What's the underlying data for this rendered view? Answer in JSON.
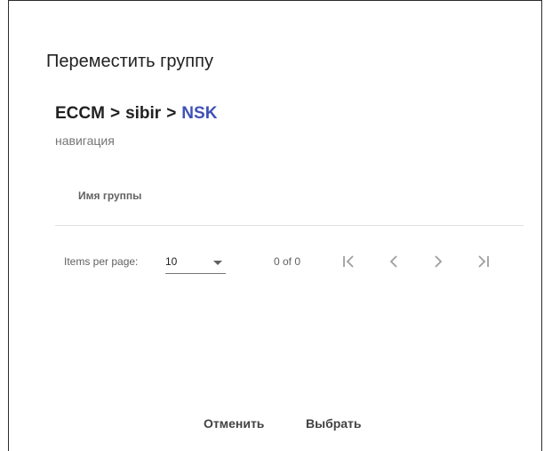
{
  "dialog": {
    "title": "Переместить группу",
    "breadcrumb": {
      "root": "ECCM",
      "separator": ">",
      "middle": "sibir",
      "current": "NSK"
    },
    "caption": "навигация"
  },
  "table": {
    "columns": [
      "Имя группы"
    ],
    "rows": []
  },
  "paginator": {
    "items_per_page_label": "Items per page:",
    "page_size": "10",
    "range": "0 of 0"
  },
  "actions": {
    "cancel_label": "Отменить",
    "select_label": "Выбрать"
  },
  "colors": {
    "accent": "#3f51b5",
    "text": "#212121",
    "muted": "#757575",
    "icon_disabled": "#9e9e9e"
  }
}
